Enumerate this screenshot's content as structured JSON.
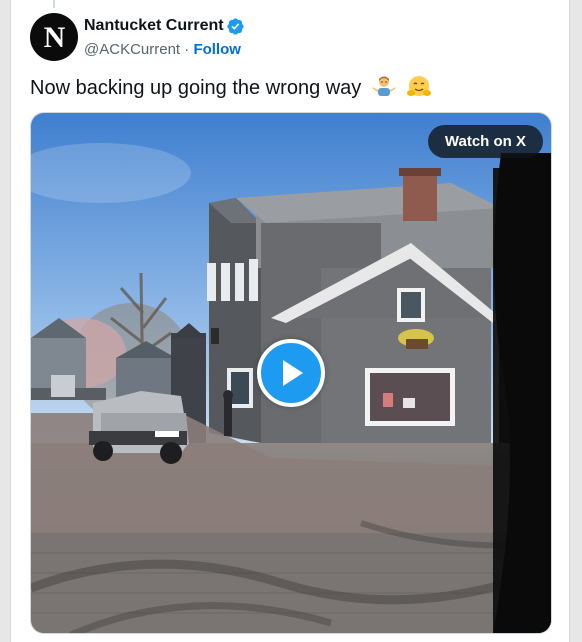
{
  "post": {
    "author": {
      "display_name": "Nantucket Current",
      "handle": "@ACKCurrent",
      "separator": "·",
      "follow_label": "Follow",
      "avatar_letter": "N",
      "verified": true
    },
    "text": "Now backing up going the wrong way",
    "emojis": [
      "man-shrugging-emoji",
      "hugging-face-emoji"
    ],
    "media": {
      "type": "video",
      "overlay_label": "Watch on X",
      "play_icon": "play-icon"
    }
  },
  "colors": {
    "link": "#006fd6",
    "verified": "#1d9bf0",
    "play_button": "#1d9bf0",
    "text_primary": "#0f1419",
    "text_secondary": "#536471"
  }
}
